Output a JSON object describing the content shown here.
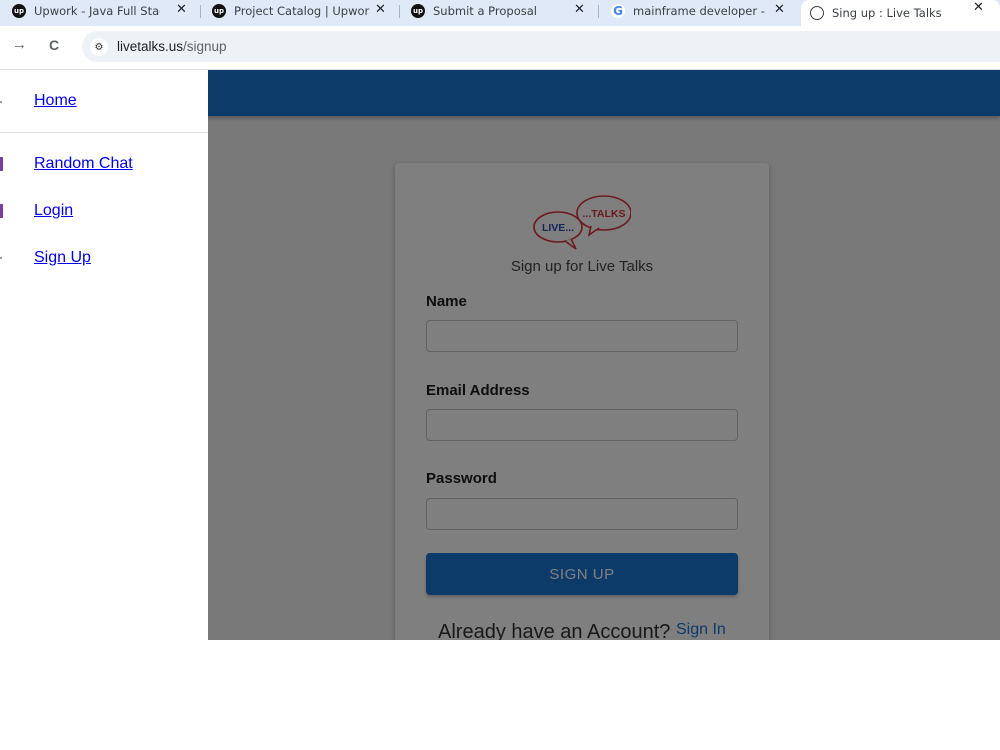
{
  "browser": {
    "tabs": [
      {
        "title": "Upwork - Java Full Stack D",
        "icon": "upwork-icon",
        "active": false
      },
      {
        "title": "Project Catalog | Upwork",
        "icon": "upwork-icon",
        "active": false
      },
      {
        "title": "Submit a Proposal",
        "icon": "upwork-icon",
        "active": false
      },
      {
        "title": "mainframe developer - G",
        "icon": "google-icon",
        "active": false
      },
      {
        "title": "Sing up : Live Talks",
        "icon": "globe-icon",
        "active": true
      }
    ],
    "tab_close_glyph": "✕",
    "favicon_up": "up",
    "favicon_g": "G",
    "forward_glyph": "→",
    "reload_glyph": "C",
    "site_info_glyph": "⚙",
    "url_host": "livetalks.us",
    "url_path": "/signup"
  },
  "drawer": {
    "items": [
      {
        "label": "Home"
      },
      {
        "label": "Random Chat"
      },
      {
        "label": "Login"
      },
      {
        "label": "Sign Up"
      }
    ]
  },
  "card": {
    "logo_text_left": "LIVE...",
    "logo_text_right": "...TALKS",
    "subtitle": "Sign up for Live Talks",
    "name_label": "Name",
    "email_label": "Email Address",
    "password_label": "Password",
    "submit_label": "SIGN UP",
    "already_text": "Already have an Account?",
    "signin_label": "Sign In"
  },
  "colors": {
    "primary": "#1976d2",
    "logo_red": "#d9343b",
    "logo_blue": "#2b4bb5",
    "link": "#0000ee"
  }
}
